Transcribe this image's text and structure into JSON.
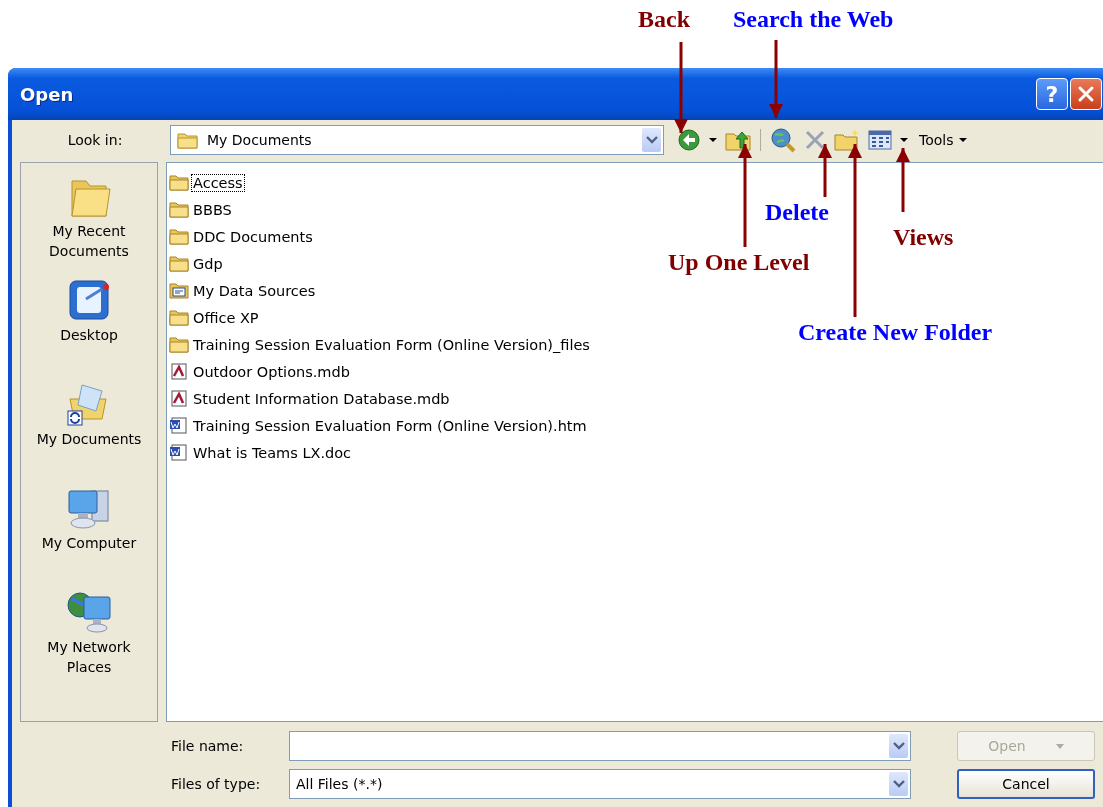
{
  "callouts": [
    {
      "text": "Back",
      "color": "#800000"
    },
    {
      "text": "Search the Web",
      "color": "#0000ff"
    },
    {
      "text": "Delete",
      "color": "#0000ff"
    },
    {
      "text": "Views",
      "color": "#800000"
    },
    {
      "text": "Up One Level",
      "color": "#800000"
    },
    {
      "text": "Create New Folder",
      "color": "#0000ff"
    }
  ],
  "window": {
    "title": "Open",
    "help_button": "?"
  },
  "look_in": {
    "label": "Look in:",
    "value": "My Documents"
  },
  "toolbar": {
    "tools_label": "Tools"
  },
  "places": [
    {
      "label": "My Recent Documents",
      "kind": "recent"
    },
    {
      "label": "Desktop",
      "kind": "desktop"
    },
    {
      "label": "My Documents",
      "kind": "documents"
    },
    {
      "label": "My Computer",
      "kind": "computer"
    },
    {
      "label": "My Network Places",
      "kind": "network"
    }
  ],
  "files": [
    {
      "name": "Access",
      "kind": "folder",
      "selected": true
    },
    {
      "name": "BBBS",
      "kind": "folder",
      "selected": false
    },
    {
      "name": "DDC Documents",
      "kind": "folder",
      "selected": false
    },
    {
      "name": "Gdp",
      "kind": "folder",
      "selected": false
    },
    {
      "name": "My Data Sources",
      "kind": "datasource",
      "selected": false
    },
    {
      "name": "Office XP",
      "kind": "folder",
      "selected": false
    },
    {
      "name": "Training Session Evaluation Form (Online Version)_files",
      "kind": "folder",
      "selected": false
    },
    {
      "name": "Outdoor Options.mdb",
      "kind": "database",
      "selected": false
    },
    {
      "name": "Student Information Database.mdb",
      "kind": "database",
      "selected": false
    },
    {
      "name": "Training Session Evaluation Form (Online Version).htm",
      "kind": "document",
      "selected": false
    },
    {
      "name": "What is Teams LX.doc",
      "kind": "document",
      "selected": false
    }
  ],
  "file_name": {
    "label": "File name:"
  },
  "file_type": {
    "label": "Files of type:",
    "value": "All Files (*.*)"
  },
  "buttons": [
    {
      "label": "Open",
      "disabled": true
    },
    {
      "label": "Cancel",
      "disabled": false
    }
  ]
}
